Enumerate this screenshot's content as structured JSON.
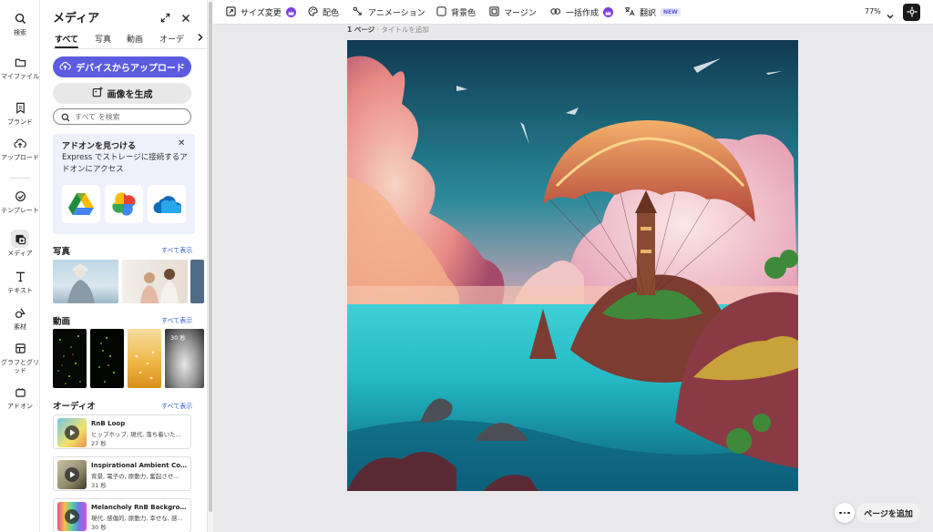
{
  "rail": {
    "items": [
      {
        "label": "検索",
        "icon": "search-icon"
      },
      {
        "label": "マイファイル",
        "icon": "folder-icon"
      },
      {
        "label": "ブランド",
        "icon": "brand-icon"
      },
      {
        "label": "アップロード",
        "icon": "upload-cloud-icon"
      },
      {
        "label": "テンプレート",
        "icon": "template-icon"
      },
      {
        "label": "メディア",
        "icon": "media-icon"
      },
      {
        "label": "テキスト",
        "icon": "text-icon"
      },
      {
        "label": "素材",
        "icon": "shapes-icon"
      },
      {
        "label": "グラフとグリッド",
        "icon": "grid-icon"
      },
      {
        "label": "アドオン",
        "icon": "addon-icon"
      }
    ]
  },
  "panel": {
    "title": "メディア",
    "tabs": [
      "すべて",
      "写真",
      "動画",
      "オーデ"
    ],
    "upload_label": "デバイスからアップロード",
    "generate_label": "画像を生成",
    "search_placeholder": "すべて を検索",
    "addon": {
      "title": "アドオンを見つける",
      "description": "Express でストレージに接続するアドオンにアクセス",
      "apps": [
        "google-drive-icon",
        "google-photos-icon",
        "onedrive-icon"
      ]
    },
    "photos": {
      "title": "写真",
      "link": "すべて表示"
    },
    "videos": {
      "title": "動画",
      "link": "すべて表示",
      "duration_badge": "30 秒"
    },
    "audio": {
      "title": "オーディオ",
      "link": "すべて表示",
      "items": [
        {
          "title": "RnB Loop",
          "tags": "ヒップホップ, 現代, 落ち着いた...",
          "duration": "27 秒"
        },
        {
          "title": "Inspirational Ambient Corp...",
          "tags": "背景, 電子の, 原動力, 奮起させ...",
          "duration": "31 秒"
        },
        {
          "title": "Melancholy RnB Backgroun...",
          "tags": "現代, 感傷的, 原動力, 幸せな, 感...",
          "duration": "30 秒"
        }
      ]
    }
  },
  "toolbar": {
    "resize": "サイズ変更",
    "color": "配色",
    "animation": "アニメーション",
    "background": "背景色",
    "margin": "マージン",
    "batch": "一括作成",
    "translate": "翻訳",
    "new_badge": "NEW",
    "zoom": "77%"
  },
  "page": {
    "number": "1 ページ",
    "title_placeholder": "タイトルを追加"
  },
  "footer": {
    "add_page": "ページを追加"
  },
  "colors": {
    "accent": "#5c5ce0",
    "premium": "#7e3fe0"
  }
}
